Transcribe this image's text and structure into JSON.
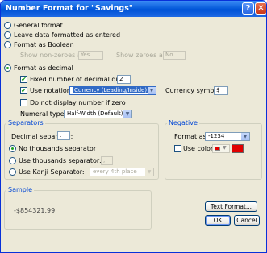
{
  "window": {
    "title": "Number Format for \"Savings\"",
    "help_glyph": "?",
    "close_glyph": "✕"
  },
  "formats": {
    "general": "General format",
    "leave": "Leave data formatted as entered",
    "boolean": "Format as Boolean",
    "show_nonzeroes_label": "Show non-zeroes as:",
    "show_nonzeroes_value": "Yes",
    "show_zeroes_label": "Show zeroes as:",
    "show_zeroes_value": "No",
    "decimal": "Format as decimal",
    "selected": "decimal"
  },
  "decimal": {
    "fixed_label": "Fixed number of decimal digits:",
    "fixed_value": "2",
    "fixed_checked": true,
    "notation_label": "Use notation:",
    "notation_value": "Currency (Leading/Inside)",
    "notation_checked": true,
    "currency_symbol_label": "Currency symbol:",
    "currency_symbol_value": "$",
    "no_zero_label": "Do not display number if zero",
    "no_zero_checked": false,
    "numeral_type_label": "Numeral type:",
    "numeral_type_value": "Half-Width (Default)"
  },
  "separators": {
    "title": "Separators",
    "decimal_sep_label": "Decimal separator:",
    "decimal_sep_value": ".",
    "no_thousands": "No thousands separator",
    "use_thousands": "Use thousands separator:",
    "thousands_value": ",",
    "use_kanji": "Use Kanji Separator:",
    "kanji_value": "every 4th place",
    "selected": "no_thousands"
  },
  "negative": {
    "title": "Negative",
    "format_as_label": "Format as:",
    "format_as_value": "-1234",
    "use_color_label": "Use color:",
    "use_color_checked": false,
    "color": "#e00000"
  },
  "sample": {
    "title": "Sample",
    "value": "-$854321.99"
  },
  "buttons": {
    "text_format": "Text Format...",
    "ok": "OK",
    "cancel": "Cancel"
  },
  "colors": {
    "title_bar": "#0a5fdc",
    "dialog_bg": "#ece9d8",
    "group_title": "#0046d5"
  }
}
